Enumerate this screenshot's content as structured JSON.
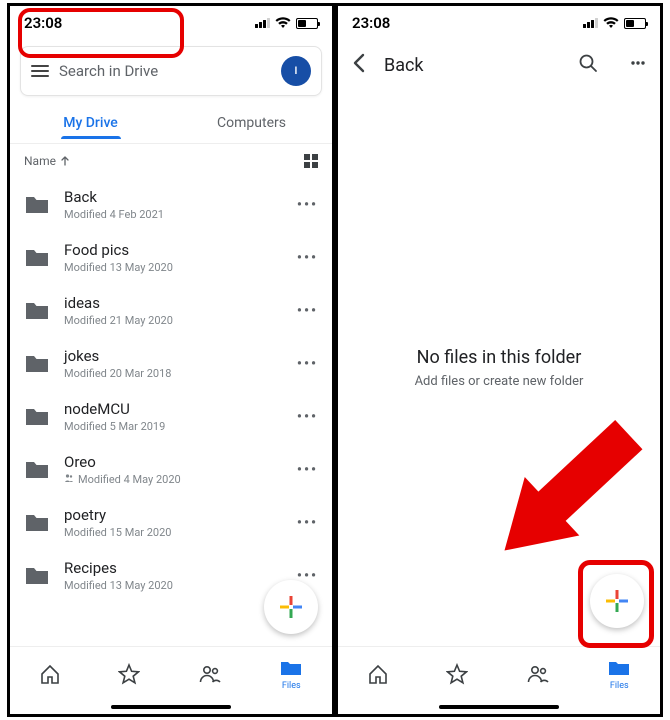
{
  "status": {
    "time": "23:08"
  },
  "left": {
    "search_placeholder": "Search in Drive",
    "avatar_letter": "I",
    "tabs": {
      "my_drive": "My Drive",
      "computers": "Computers"
    },
    "sort_label": "Name",
    "files": [
      {
        "name": "Back",
        "sub": "Modified 4 Feb 2021",
        "shared": false
      },
      {
        "name": "Food pics",
        "sub": "Modified 13 May 2020",
        "shared": false
      },
      {
        "name": "ideas",
        "sub": "Modified 21 May 2020",
        "shared": false
      },
      {
        "name": "jokes",
        "sub": "Modified 20 Mar 2018",
        "shared": false
      },
      {
        "name": "nodeMCU",
        "sub": "Modified 5 Mar 2019",
        "shared": false
      },
      {
        "name": "Oreo",
        "sub": "Modified 4 May 2020",
        "shared": true
      },
      {
        "name": "poetry",
        "sub": "Modified 15 Mar 2020",
        "shared": false
      },
      {
        "name": "Recipes",
        "sub": "Modified 13 May 2020",
        "shared": false
      }
    ],
    "nav_files_label": "Files"
  },
  "right": {
    "back_label": "Back",
    "empty_title": "No files in this folder",
    "empty_sub": "Add files or create new folder",
    "nav_files_label": "Files"
  },
  "colors": {
    "highlight": "#e60000",
    "accent": "#1a73e8"
  }
}
